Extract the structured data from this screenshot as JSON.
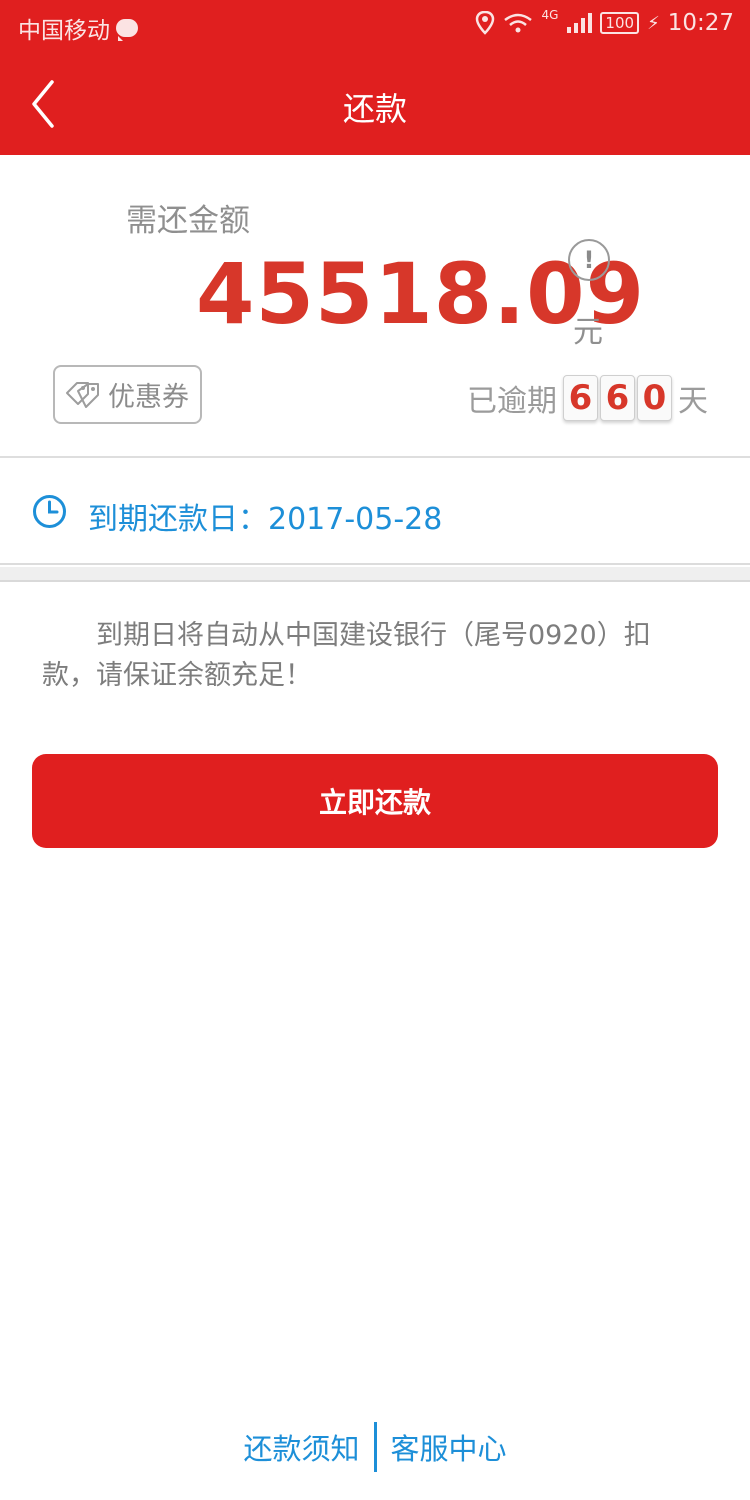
{
  "status_bar": {
    "carrier": "中国移动",
    "battery": "100",
    "time": "10:27",
    "signal_label": "4G"
  },
  "header": {
    "title": "还款"
  },
  "repayment": {
    "amount_label": "需还金额",
    "amount": "45518.09",
    "unit": "元",
    "coupon_label": "优惠券",
    "overdue_label": "已逾期",
    "overdue_digits": [
      "6",
      "6",
      "0"
    ],
    "overdue_unit": "天"
  },
  "due_date": {
    "label": "到期还款日：2017-05-28"
  },
  "notice": {
    "text": "到期日将自动从中国建设银行（尾号0920）扣款，请保证余额充足！"
  },
  "actions": {
    "pay_now": "立即还款"
  },
  "footer": {
    "repay_notice": "还款须知",
    "service_center": "客服中心"
  },
  "colors": {
    "brand_red": "#e01f1f",
    "amount_red": "#d7372a",
    "link_blue": "#1d8fd8"
  }
}
